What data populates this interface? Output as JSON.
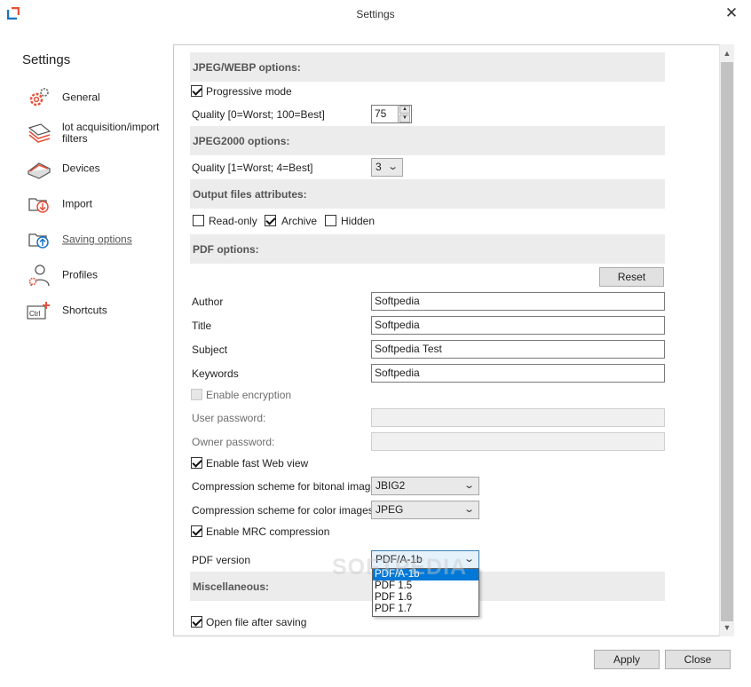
{
  "window": {
    "title": "Settings",
    "close_glyph": "✕"
  },
  "sidebar": {
    "title": "Settings",
    "items": [
      {
        "label": "General",
        "icon": "gears-icon"
      },
      {
        "label": "lot acquisition/import filters",
        "icon": "stacked-papers-icon"
      },
      {
        "label": "Devices",
        "icon": "scanner-icon"
      },
      {
        "label": "Import",
        "icon": "folder-import-icon"
      },
      {
        "label": "Saving options",
        "icon": "folder-save-icon"
      },
      {
        "label": "Profiles",
        "icon": "user-profile-icon"
      },
      {
        "label": "Shortcuts",
        "icon": "ctrl-key-icon"
      }
    ]
  },
  "jpeg": {
    "header": "JPEG/WEBP options:",
    "progressive_label": "Progressive mode",
    "quality_label": "Quality [0=Worst; 100=Best]",
    "quality_value": "75"
  },
  "jpeg2000": {
    "header": "JPEG2000 options:",
    "quality_label": "Quality [1=Worst; 4=Best]",
    "quality_value": "3"
  },
  "attributes": {
    "header": "Output files attributes:",
    "readonly": "Read-only",
    "archive": "Archive",
    "hidden": "Hidden"
  },
  "pdf": {
    "header": "PDF options:",
    "reset_label": "Reset",
    "author_label": "Author",
    "author_value": "Softpedia",
    "title_label": "Title",
    "title_value": "Softpedia",
    "subject_label": "Subject",
    "subject_value": "Softpedia Test",
    "keywords_label": "Keywords",
    "keywords_value": "Softpedia",
    "encryption_label": "Enable encryption",
    "user_password_label": "User password:",
    "owner_password_label": "Owner password:",
    "fast_web_label": "Enable fast Web view",
    "bitonal_label": "Compression scheme for bitonal images:",
    "bitonal_value": "JBIG2",
    "color_label": "Compression scheme for color images:",
    "color_value": "JPEG",
    "mrc_label": "Enable MRC compression",
    "version_label": "PDF version",
    "version_value": "PDF/A-1b",
    "version_options": [
      "PDF/A-1b",
      "PDF 1.5",
      "PDF 1.6",
      "PDF 1.7"
    ]
  },
  "misc": {
    "header": "Miscellaneous:",
    "open_after_label": "Open file after saving"
  },
  "footer": {
    "apply_label": "Apply",
    "close_label": "Close"
  },
  "watermark": "SOFTPEDIA",
  "colors": {
    "accent": "#0078d7",
    "icon_red": "#e8503a",
    "icon_blue": "#1a73c6",
    "section_bg": "#ececec"
  }
}
